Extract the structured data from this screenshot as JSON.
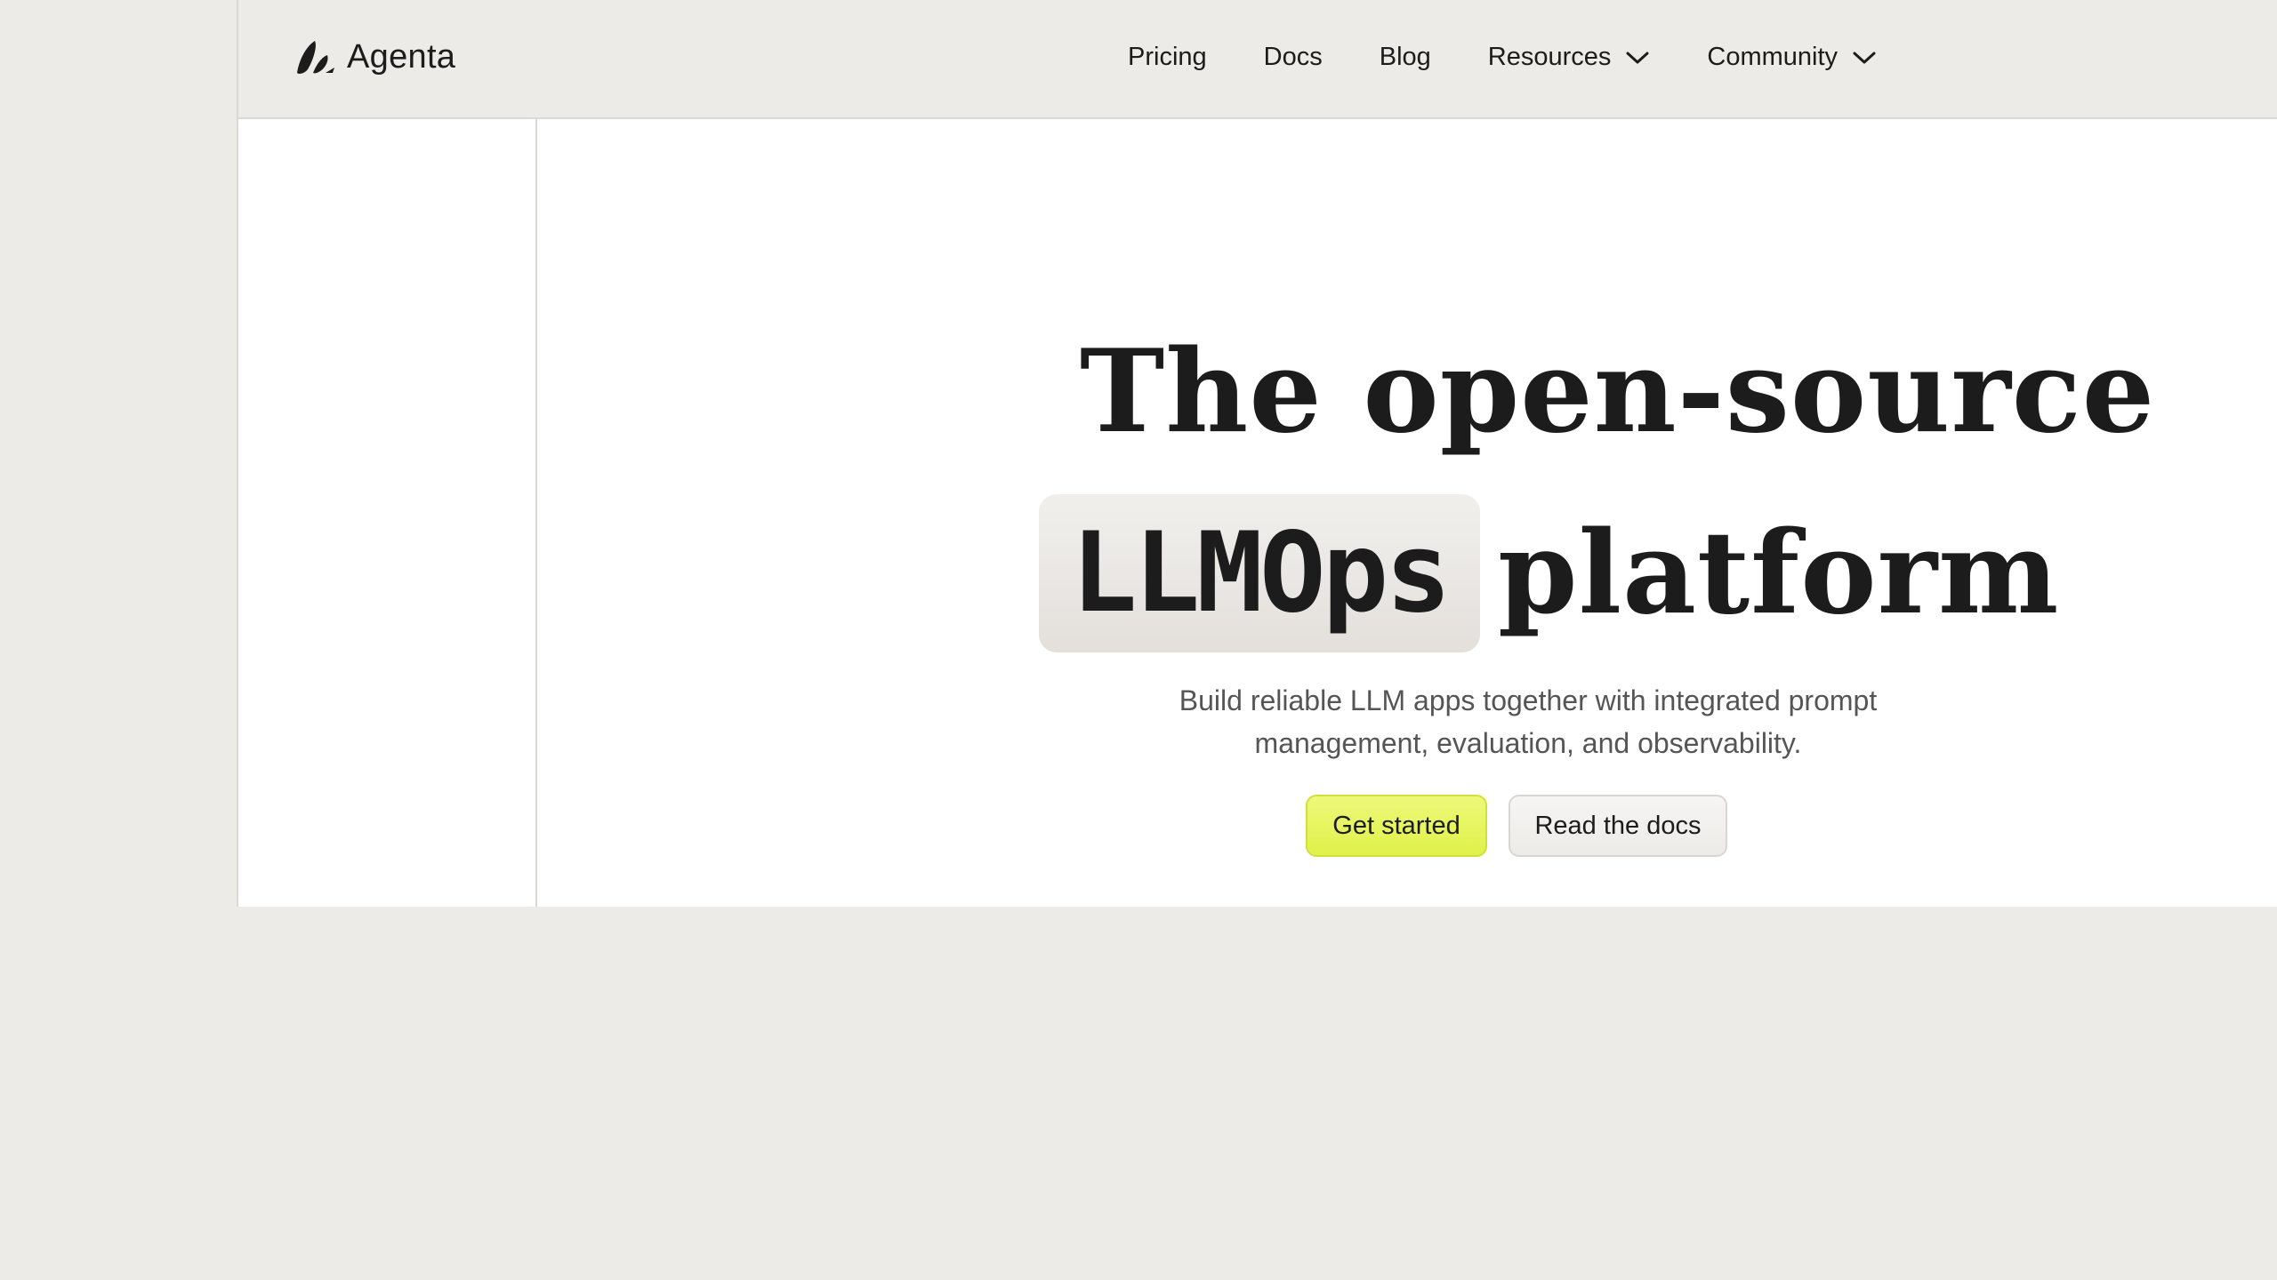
{
  "header": {
    "brand": "Agenta",
    "nav": [
      {
        "label": "Pricing",
        "has_dropdown": false
      },
      {
        "label": "Docs",
        "has_dropdown": false
      },
      {
        "label": "Blog",
        "has_dropdown": false
      },
      {
        "label": "Resources",
        "has_dropdown": true
      },
      {
        "label": "Community",
        "has_dropdown": true
      }
    ]
  },
  "hero": {
    "title_line1": "The open-source",
    "title_highlight": "LLMOps",
    "title_line2_rest": "platform",
    "subtitle": "Build reliable LLM apps together with integrated prompt management, evaluation, and observability.",
    "primary_cta": "Get started",
    "secondary_cta": "Read the docs"
  },
  "colors": {
    "page_bg": "#edebe7",
    "content_bg": "#ffffff",
    "accent": "#e4f55a",
    "text": "#1c1c1c",
    "muted_text": "#555555"
  },
  "icons": {
    "logo": "agenta-logo-icon",
    "dropdown": "chevron-down-icon"
  }
}
